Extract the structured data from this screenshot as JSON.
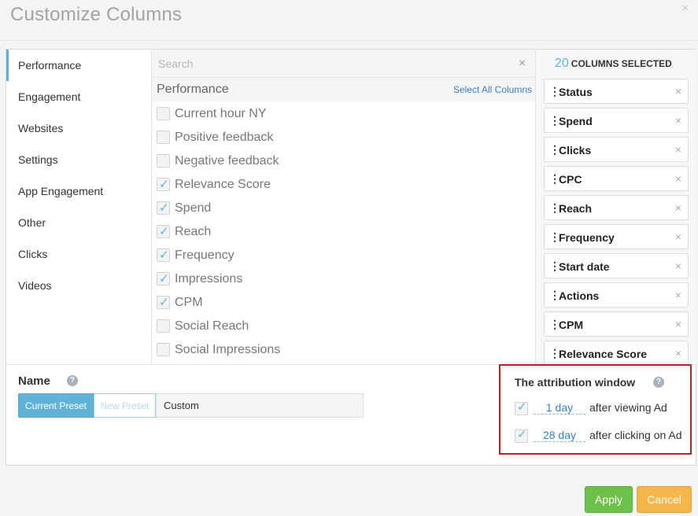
{
  "dialog": {
    "title": "Customize Columns",
    "close_glyph": "×"
  },
  "nav": {
    "items": [
      {
        "label": "Performance",
        "active": true
      },
      {
        "label": "Engagement"
      },
      {
        "label": "Websites"
      },
      {
        "label": "Settings"
      },
      {
        "label": "App Engagement"
      },
      {
        "label": "Other"
      },
      {
        "label": "Clicks"
      },
      {
        "label": "Videos"
      }
    ]
  },
  "search": {
    "placeholder": "Search",
    "clear_glyph": "×"
  },
  "section": {
    "title": "Performance",
    "select_all_label": "Select All Columns",
    "options": [
      {
        "label": "Current hour NY",
        "checked": false
      },
      {
        "label": "Positive feedback",
        "checked": false
      },
      {
        "label": "Negative feedback",
        "checked": false
      },
      {
        "label": "Relevance Score",
        "checked": true
      },
      {
        "label": "Spend",
        "checked": true
      },
      {
        "label": "Reach",
        "checked": true
      },
      {
        "label": "Frequency",
        "checked": true
      },
      {
        "label": "Impressions",
        "checked": true
      },
      {
        "label": "CPM",
        "checked": true
      },
      {
        "label": "Social Reach",
        "checked": false
      },
      {
        "label": "Social Impressions",
        "checked": false
      }
    ]
  },
  "selected": {
    "count": "20",
    "count_label": "COLUMNS SELECTED",
    "handle_glyph": "⋮",
    "remove_glyph": "×",
    "items": [
      {
        "label": "Status"
      },
      {
        "label": "Spend"
      },
      {
        "label": "Clicks"
      },
      {
        "label": "CPC"
      },
      {
        "label": "Reach"
      },
      {
        "label": "Frequency"
      },
      {
        "label": "Start date"
      },
      {
        "label": "Actions"
      },
      {
        "label": "CPM"
      },
      {
        "label": "Relevance Score"
      }
    ]
  },
  "preset": {
    "name_label": "Name",
    "help_glyph": "?",
    "current_label": "Current Preset",
    "new_label": "New Preset",
    "value": "Custom"
  },
  "attribution": {
    "title": "The attribution window",
    "help_glyph": "?",
    "rows": [
      {
        "value": "1 day",
        "suffix": "after viewing Ad",
        "checked": true
      },
      {
        "value": "28 day",
        "suffix": "after clicking on Ad",
        "checked": true
      }
    ]
  },
  "footer": {
    "apply_label": "Apply",
    "cancel_label": "Cancel"
  },
  "colors": {
    "accent": "#5fb3d9",
    "apply": "#6dc04a",
    "cancel": "#f6b74a",
    "highlight_border": "#b42323",
    "link": "#3b7fc4"
  }
}
